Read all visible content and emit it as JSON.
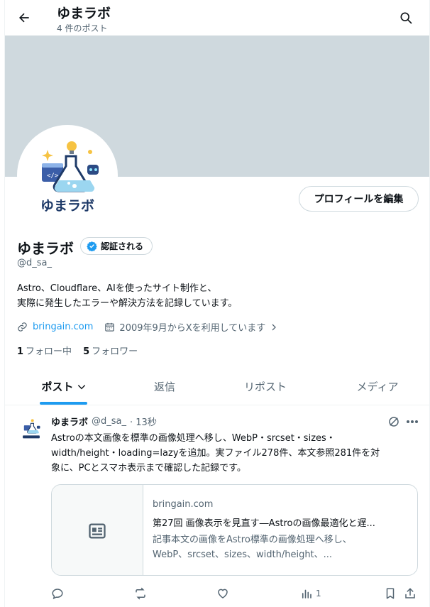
{
  "header": {
    "title": "ゆまラボ",
    "subtitle": "4 件のポスト"
  },
  "profile": {
    "logo_text": "ゆまラボ",
    "edit_button": "プロフィールを編集",
    "name": "ゆまラボ",
    "verified_label": "認証される",
    "handle": "@d_sa_",
    "bio_line1": "Astro、Cloudflare、AIを使ったサイト制作と、",
    "bio_line2": "実際に発生したエラーや解決方法を記録しています。",
    "link": "bringain.com",
    "joined": "2009年9月からXを利用しています",
    "following_count": "1",
    "following_label": "フォロー中",
    "followers_count": "5",
    "followers_label": "フォロワー"
  },
  "tabs": [
    {
      "label": "ポスト"
    },
    {
      "label": "返信"
    },
    {
      "label": "リポスト"
    },
    {
      "label": "メディア"
    }
  ],
  "post": {
    "name": "ゆまラボ",
    "handle": "@d_sa_",
    "time": "· 13秒",
    "text_line1": "Astroの本文画像を標準の画像処理へ移し、WebP・srcset・sizes・",
    "text_line2": "width/height・loading=lazyを追加。実ファイル278件、本文参照281件を対",
    "text_line3": "象に、PCとスマホ表示まで確認した記録です。",
    "card": {
      "domain": "bringain.com",
      "title": "第27回 画像表示を見直す―Astroの画像最適化と遅...",
      "desc_line1": "記事本文の画像をAstro標準の画像処理へ移し、",
      "desc_line2": "WebP、srcset、sizes、width/height、..."
    },
    "views": "1"
  },
  "colors": {
    "accent": "#1d9bf0",
    "banner": "#cfd9de",
    "text_secondary": "#536471"
  }
}
